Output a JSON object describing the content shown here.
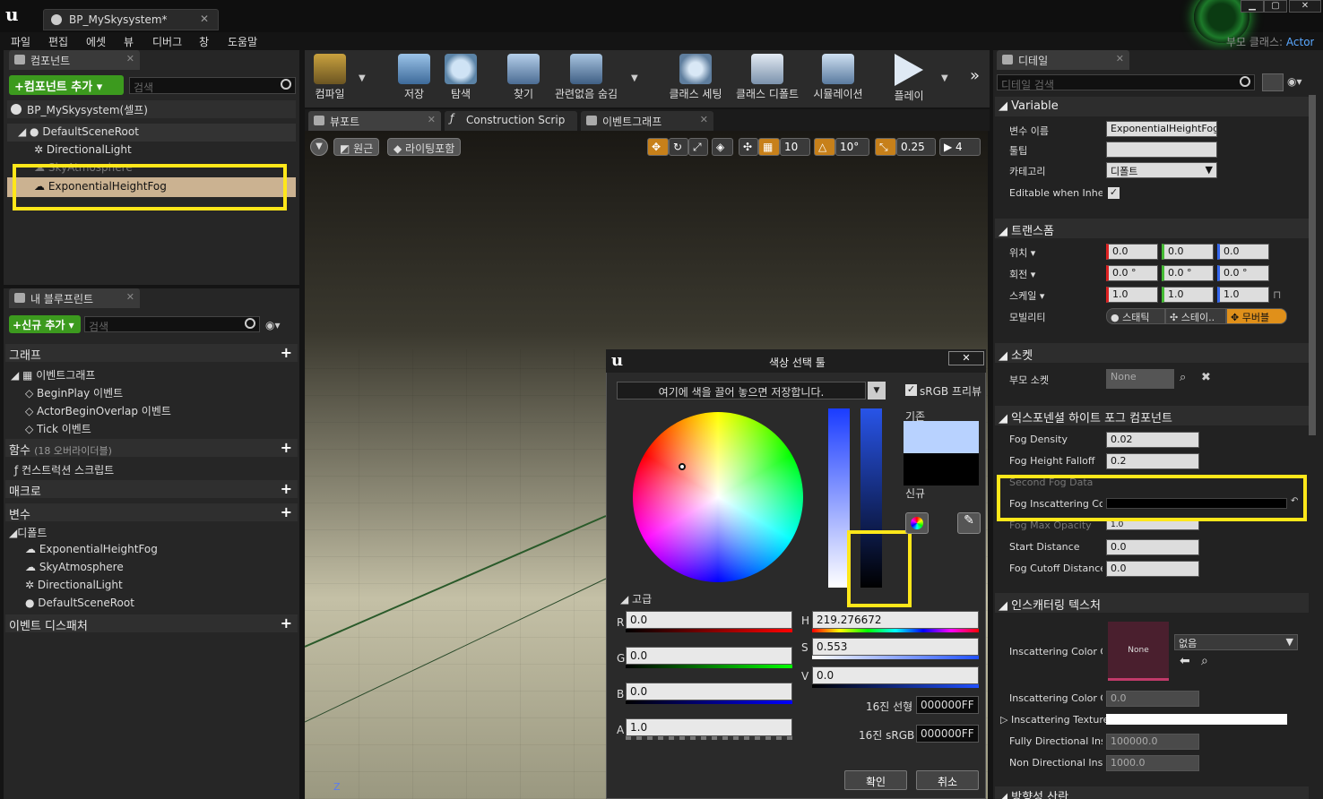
{
  "window": {
    "tab_title": "BP_MySkysystem*",
    "parent_class_label": "부모 클래스:",
    "parent_class_value": "Actor",
    "win_min": "▁",
    "win_max": "▢",
    "win_close": "✕"
  },
  "menu": [
    "파일",
    "편집",
    "에셋",
    "뷰",
    "디버그",
    "창",
    "도움말"
  ],
  "components": {
    "tab": "컴포넌트",
    "add_button": "+컴포넌트 추가 ▾",
    "search_placeholder": "검색",
    "self": "BP_MySkysystem(셀프)",
    "tree": [
      "DefaultSceneRoot",
      "DirectionalLight",
      "SkyAtmosphere",
      "ExponentialHeightFog"
    ]
  },
  "myblueprint": {
    "tab": "내 블루프린트",
    "add_button": "+신규 추가 ▾",
    "search_placeholder": "검색",
    "graph_section": "그래프",
    "event_graph": "이벤트그래프",
    "events": [
      "BeginPlay 이벤트",
      "ActorBeginOverlap 이벤트",
      "Tick 이벤트"
    ],
    "functions_section": "함수",
    "functions_overridable": "(18 오버라이더블)",
    "construction_script": "컨스트럭션 스크립트",
    "macros_section": "매크로",
    "variables_section": "변수",
    "default_section": "디폴트",
    "default_vars": [
      "ExponentialHeightFog",
      "SkyAtmosphere",
      "DirectionalLight",
      "DefaultSceneRoot"
    ],
    "dispatchers_section": "이벤트 디스패처"
  },
  "toolbar": [
    "컴파일",
    "저장",
    "탐색",
    "찾기",
    "관련없음 숨김",
    "클래스 세팅",
    "클래스 디폴트",
    "시뮬레이션",
    "플레이"
  ],
  "editor_tabs": [
    "뷰포트",
    "Construction Scrip",
    "이벤트그래프"
  ],
  "viewport": {
    "perspective": "원근",
    "lighting": "라이팅포함",
    "grid": "10",
    "rot": "10°",
    "scale": "0.25",
    "cam": "4",
    "axis_label": "Z"
  },
  "picker": {
    "title": "색상 선택 툴",
    "swatch_hint": "여기에 색을 끌어 놓으면 저장합니다.",
    "srgb_preview": "sRGB 프리뷰",
    "old_label": "기존",
    "new_label": "신규",
    "advanced": "고급",
    "R": "0.0",
    "G": "0.0",
    "B": "0.0",
    "A": "1.0",
    "H": "219.276672",
    "S": "0.553",
    "V": "0.0",
    "hex_linear_label": "16진 선형",
    "hex_linear": "000000FF",
    "hex_srgb_label": "16진 sRGB",
    "hex_srgb": "000000FF",
    "ok": "확인",
    "cancel": "취소",
    "old_color": "#b8d2ff",
    "new_color": "#000000"
  },
  "details": {
    "tab": "디테일",
    "search_placeholder": "디테일 검색",
    "variable_section": "Variable",
    "var_name_label": "변수 이름",
    "var_name": "ExponentialHeightFog",
    "tooltip_label": "툴팁",
    "category_label": "카테고리",
    "category": "디폴트",
    "editable_label": "Editable when Inherit",
    "transform_section": "트랜스폼",
    "location_label": "위치 ▾",
    "rotation_label": "회전 ▾",
    "scale_label": "스케일 ▾",
    "mobility_label": "모빌리티",
    "loc": [
      "0.0",
      "0.0",
      "0.0"
    ],
    "rot": [
      "0.0 °",
      "0.0 °",
      "0.0 °"
    ],
    "scale": [
      "1.0",
      "1.0",
      "1.0"
    ],
    "mobility": [
      "스태틱",
      "스테이..",
      "무버블"
    ],
    "sockets_section": "소켓",
    "parent_socket_label": "부모 소켓",
    "parent_socket": "None",
    "fog_section": "익스포넨셜 하이트 포그 컴포넌트",
    "fog_density_label": "Fog Density",
    "fog_density": "0.02",
    "fog_falloff_label": "Fog Height Falloff",
    "fog_falloff": "0.2",
    "second_fog_label": "Second Fog Data",
    "fog_color_label": "Fog Inscattering Colo",
    "fog_max_opacity_label": "Fog Max Opacity",
    "fog_max_opacity": "1.0",
    "start_distance_label": "Start Distance",
    "start_distance": "0.0",
    "cutoff_label": "Fog Cutoff Distance",
    "cutoff": "0.0",
    "texture_section": "인스캐터링 텍스처",
    "inscat_cube_label": "Inscattering Color Cu",
    "inscat_none": "None",
    "inscat_select": "없음",
    "inscat_angle_label": "Inscattering Color Cu",
    "inscat_angle": "0.0",
    "inscat_tex_label": "Inscattering Texture",
    "fully_dir_label": "Fully Directional Insc",
    "fully_dir": "100000.0",
    "non_dir_label": "Non Directional Insca",
    "non_dir": "1000.0",
    "more_section": "방향성 산란"
  }
}
